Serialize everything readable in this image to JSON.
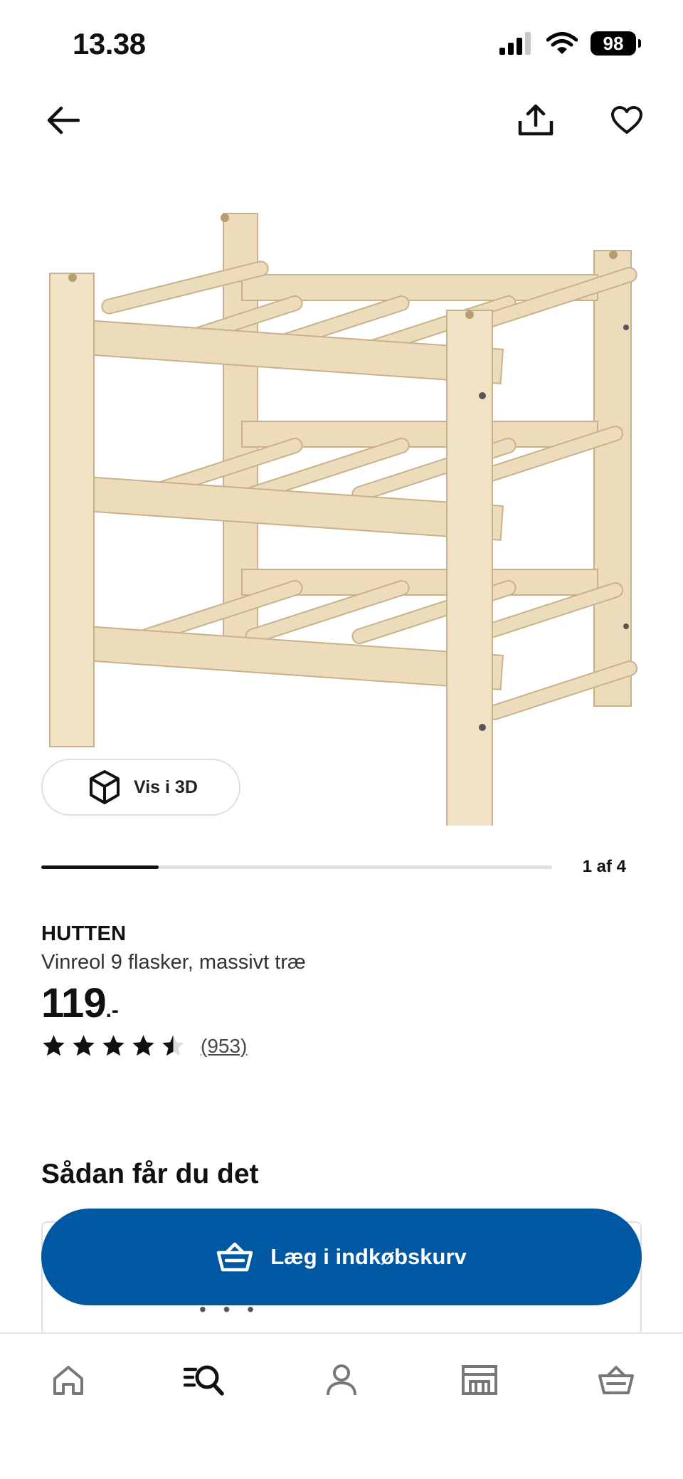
{
  "status_bar": {
    "time": "13.38",
    "battery": "98"
  },
  "icons": {
    "back": "arrow-left-icon",
    "share": "share-icon",
    "favourite": "heart-icon",
    "view_3d": "cube-icon",
    "cart": "basket-icon"
  },
  "gallery": {
    "view_3d_label": "Vis i 3D",
    "counter": "1 af 4",
    "progress": 0.23
  },
  "product": {
    "brand": "HUTTEN",
    "description": "Vinreol 9 flasker, massivt træ",
    "price_integer": "119",
    "price_suffix": ".-",
    "rating_value": 4.5,
    "rating_max": 5,
    "review_count": "(953)"
  },
  "delivery": {
    "title": "Sådan får du det"
  },
  "add_to_cart": {
    "label": "Læg i indkøbskurv",
    "color": "#0058a3"
  },
  "bottom_nav": [
    {
      "name": "home-icon",
      "active": false
    },
    {
      "name": "search-icon",
      "active": true
    },
    {
      "name": "profile-icon",
      "active": false
    },
    {
      "name": "store-icon",
      "active": false
    },
    {
      "name": "basket-icon",
      "active": false
    }
  ]
}
